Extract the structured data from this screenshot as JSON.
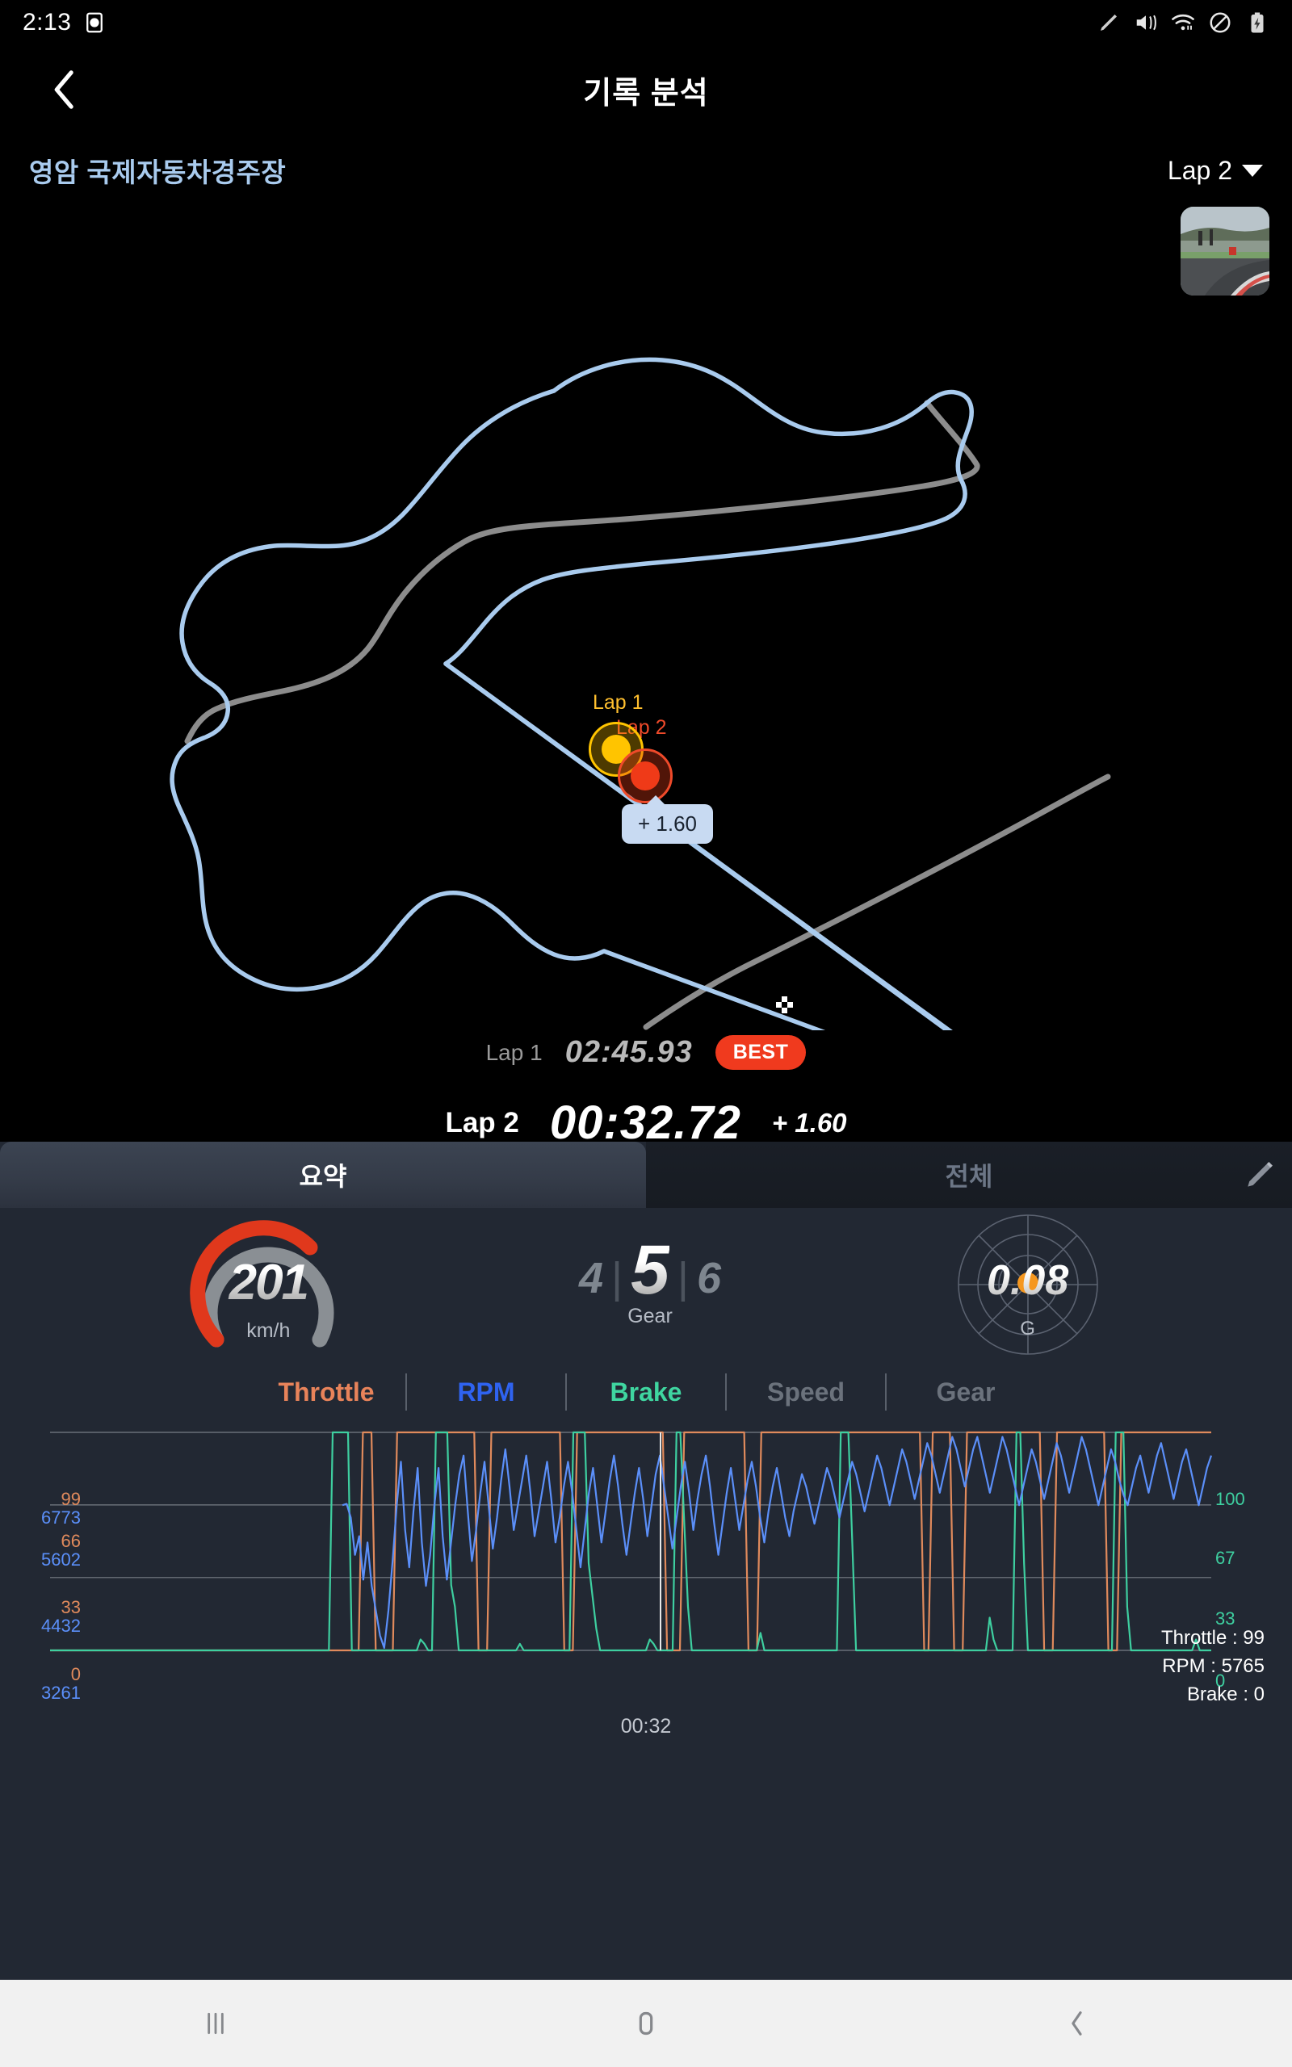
{
  "status_bar": {
    "time": "2:13",
    "icons": [
      "stylus-icon",
      "mute-vibrate-icon",
      "wifi-icon",
      "do-not-disturb-icon",
      "battery-charging-icon"
    ]
  },
  "header": {
    "title": "기록 분석",
    "back_icon": "back-chevron-icon"
  },
  "track": {
    "name": "영암 국제자동차경주장",
    "lap_selector": "Lap 2",
    "caret_icon": "chevron-down-icon",
    "thumbnail_label": "track-photo-thumbnail"
  },
  "map": {
    "marker1_label": "Lap 1",
    "marker2_label": "Lap 2",
    "tooltip": "+ 1.60",
    "marker1_color": "#ffc400",
    "marker2_color": "#ef3a18",
    "reference_line_color": "#a9cbee",
    "comparison_line_color": "#8c8c8c"
  },
  "laps": {
    "lap1_name": "Lap 1",
    "lap1_time": "02:45.93",
    "best_badge": "BEST",
    "lap2_name": "Lap 2",
    "lap2_time": "00:32.72",
    "lap2_delta": "+ 1.60"
  },
  "tabs": {
    "summary": "요약",
    "all": "전체",
    "edit_icon": "pencil-icon",
    "active": "요약"
  },
  "gauges": {
    "speed": {
      "value": "201",
      "unit": "km/h",
      "arc_pct": 72,
      "color": "#e0381c"
    },
    "gear": {
      "prev": "4",
      "current": "5",
      "next": "6",
      "label": "Gear"
    },
    "gforce": {
      "value": "0.08",
      "label": "G",
      "dot_color": "#f5971f"
    }
  },
  "legend": [
    {
      "label": "Throttle",
      "color": "#e8835a"
    },
    {
      "label": "RPM",
      "color": "#2f63f0"
    },
    {
      "label": "Brake",
      "color": "#3fd6a0"
    },
    {
      "label": "Speed",
      "color": "#6b727c"
    },
    {
      "label": "Gear",
      "color": "#6b727c"
    }
  ],
  "hud": {
    "throttle": "Throttle : 99",
    "rpm": "RPM : 5765",
    "brake": "Brake : 0"
  },
  "chart_data": {
    "type": "line",
    "title": "",
    "xlabel": "",
    "ylabel": "",
    "x_ticks": [
      "00:32"
    ],
    "grid": true,
    "legend_position": "above",
    "axes": {
      "left_throttle": {
        "ticks": [
          "99",
          "66",
          "33",
          "0"
        ],
        "color": "#e08a5c",
        "range": [
          0,
          99
        ]
      },
      "left_rpm": {
        "ticks": [
          "6773",
          "5602",
          "4432",
          "3261"
        ],
        "color": "#5b8ff9",
        "range": [
          3261,
          6773
        ]
      },
      "right_brake": {
        "ticks": [
          "100",
          "67",
          "33",
          "0"
        ],
        "color": "#3ecfa0",
        "range": [
          0,
          100
        ]
      }
    },
    "series": [
      {
        "name": "Throttle",
        "color": "#e08a5c",
        "values": [
          0,
          0,
          0,
          0,
          0,
          0,
          0,
          0,
          0,
          0,
          0,
          0,
          0,
          0,
          0,
          0,
          0,
          0,
          0,
          0,
          0,
          0,
          0,
          0,
          0,
          0,
          0,
          0,
          0,
          0,
          0,
          0,
          0,
          0,
          0,
          0,
          0,
          0,
          0,
          0,
          0,
          0,
          0,
          0,
          0,
          0,
          0,
          0,
          0,
          0,
          0,
          0,
          0,
          0,
          0,
          0,
          0,
          0,
          0,
          0,
          0,
          0,
          0,
          0,
          0,
          0,
          0,
          0,
          0,
          0,
          0,
          0,
          0,
          99,
          99,
          99,
          0,
          0,
          0,
          0,
          0,
          99,
          99,
          99,
          99,
          99,
          99,
          99,
          99,
          99,
          99,
          99,
          99,
          99,
          99,
          99,
          99,
          99,
          99,
          99,
          0,
          0,
          0,
          99,
          99,
          99,
          99,
          99,
          99,
          99,
          99,
          99,
          99,
          99,
          99,
          99,
          99,
          99,
          99,
          99,
          0,
          0,
          0,
          99,
          99,
          99,
          99,
          99,
          99,
          99,
          99,
          99,
          99,
          99,
          99,
          99,
          99,
          99,
          99,
          99,
          99,
          99,
          99,
          99,
          0,
          0,
          0,
          0,
          99,
          99,
          99,
          99,
          99,
          99,
          99,
          99,
          99,
          99,
          99,
          99,
          99,
          99,
          99,
          0,
          0,
          0,
          99,
          99,
          99,
          99,
          99,
          99,
          99,
          99,
          99,
          99,
          99,
          99,
          99,
          99,
          99,
          99,
          99,
          99,
          99,
          99,
          99,
          99,
          99,
          99,
          99,
          99,
          99,
          99,
          99,
          99,
          99,
          99,
          99,
          99,
          99,
          99,
          99,
          99,
          0,
          0,
          99,
          99,
          99,
          99,
          99,
          0,
          0,
          0,
          99,
          99,
          99,
          99,
          99,
          99,
          99,
          99,
          99,
          99,
          99,
          99,
          99,
          99,
          99,
          99,
          99,
          99,
          0,
          0,
          0,
          99,
          99,
          99,
          99,
          99,
          99,
          99,
          99,
          99,
          99,
          99,
          99,
          0,
          0,
          0,
          99,
          99,
          99,
          99,
          99,
          99,
          99,
          99,
          99,
          99,
          99,
          99,
          99,
          99,
          99,
          99,
          99,
          99,
          99,
          99,
          99,
          99
        ]
      },
      {
        "name": "RPM",
        "color": "#5b8ff9",
        "values": [
          null,
          null,
          null,
          null,
          null,
          null,
          null,
          null,
          null,
          null,
          null,
          null,
          null,
          null,
          null,
          null,
          null,
          null,
          null,
          null,
          null,
          null,
          null,
          null,
          null,
          null,
          null,
          null,
          null,
          null,
          null,
          null,
          null,
          null,
          null,
          null,
          null,
          null,
          null,
          null,
          null,
          null,
          null,
          null,
          null,
          null,
          null,
          null,
          null,
          null,
          null,
          null,
          null,
          null,
          null,
          null,
          null,
          null,
          null,
          null,
          null,
          null,
          null,
          null,
          null,
          null,
          null,
          null,
          null,
          null,
          5600,
          5620,
          5400,
          4800,
          5100,
          4400,
          5000,
          4300,
          3900,
          3500,
          3300,
          3900,
          4700,
          5600,
          6300,
          5200,
          4600,
          5500,
          6200,
          5000,
          4300,
          4800,
          5600,
          6200,
          5100,
          4400,
          5000,
          5600,
          6100,
          6400,
          5500,
          4700,
          5200,
          5800,
          6300,
          5600,
          4900,
          5400,
          6000,
          6500,
          5900,
          5200,
          5600,
          6000,
          6400,
          5800,
          5100,
          5500,
          5900,
          6300,
          5700,
          5000,
          5400,
          5900,
          6300,
          5800,
          5200,
          4600,
          5200,
          5800,
          6200,
          5600,
          5000,
          5500,
          6000,
          6400,
          5900,
          5300,
          4800,
          5300,
          5800,
          6200,
          5700,
          5100,
          5600,
          6100,
          6400,
          5900,
          5400,
          4900,
          5400,
          5900,
          6300,
          5800,
          5200,
          5700,
          6100,
          6400,
          5900,
          5300,
          4800,
          5300,
          5800,
          6200,
          5700,
          5200,
          5600,
          6000,
          6300,
          5900,
          5400,
          5000,
          5500,
          5900,
          6200,
          5800,
          5400,
          5100,
          5500,
          5800,
          6100,
          5900,
          5600,
          5300,
          5600,
          5900,
          6200,
          6000,
          5700,
          5400,
          5700,
          6000,
          6300,
          6100,
          5800,
          5500,
          5800,
          6100,
          6400,
          6200,
          5900,
          5600,
          5900,
          6200,
          6500,
          6300,
          6000,
          5700,
          6000,
          6300,
          6600,
          6400,
          6100,
          5800,
          6100,
          6400,
          6700,
          6500,
          6200,
          5900,
          6200,
          6500,
          6700,
          6400,
          6100,
          5800,
          6100,
          6400,
          6700,
          6500,
          6200,
          5900,
          5600,
          5900,
          6200,
          6500,
          6300,
          6000,
          5700,
          6000,
          6300,
          6600,
          6400,
          6100,
          5800,
          6100,
          6400,
          6700,
          6500,
          6200,
          5900,
          5600,
          5900,
          6200,
          6500,
          6300,
          6000,
          5765,
          5600,
          5900,
          6200,
          6400,
          6100,
          5800,
          6100,
          6400,
          6600,
          6300,
          6000,
          5700,
          6000,
          6300,
          6500,
          6200,
          5900,
          5600,
          5900,
          6200,
          6400
        ]
      },
      {
        "name": "Brake",
        "color": "#3ecfa0",
        "values": [
          0,
          0,
          0,
          0,
          0,
          0,
          0,
          0,
          0,
          0,
          0,
          0,
          0,
          0,
          0,
          0,
          0,
          0,
          0,
          0,
          0,
          0,
          0,
          0,
          0,
          0,
          0,
          0,
          0,
          0,
          0,
          0,
          0,
          0,
          0,
          0,
          0,
          0,
          0,
          0,
          0,
          0,
          0,
          0,
          0,
          0,
          0,
          0,
          0,
          0,
          0,
          0,
          0,
          0,
          0,
          0,
          0,
          0,
          0,
          0,
          0,
          0,
          0,
          0,
          0,
          0,
          0,
          0,
          0,
          0,
          0,
          0,
          0,
          0,
          100,
          100,
          100,
          100,
          100,
          0,
          0,
          0,
          0,
          0,
          0,
          0,
          0,
          0,
          0,
          0,
          0,
          0,
          0,
          0,
          0,
          0,
          0,
          5,
          3,
          0,
          0,
          100,
          100,
          100,
          100,
          30,
          20,
          0,
          0,
          0,
          0,
          0,
          0,
          0,
          0,
          0,
          0,
          0,
          0,
          0,
          0,
          0,
          0,
          3,
          0,
          0,
          0,
          0,
          0,
          0,
          0,
          0,
          0,
          0,
          0,
          0,
          0,
          100,
          100,
          100,
          100,
          40,
          25,
          10,
          0,
          0,
          0,
          0,
          0,
          0,
          0,
          0,
          0,
          0,
          0,
          0,
          0,
          5,
          3,
          0,
          0,
          0,
          0,
          0,
          100,
          100,
          60,
          20,
          0,
          0,
          0,
          0,
          0,
          0,
          0,
          0,
          0,
          0,
          0,
          0,
          0,
          0,
          0,
          0,
          0,
          0,
          8,
          0,
          0,
          0,
          0,
          0,
          0,
          0,
          0,
          0,
          0,
          0,
          0,
          0,
          0,
          0,
          0,
          0,
          0,
          0,
          0,
          100,
          100,
          100,
          50,
          0,
          0,
          0,
          0,
          0,
          0,
          0,
          0,
          0,
          0,
          0,
          0,
          0,
          0,
          0,
          0,
          0,
          0,
          0,
          0,
          0,
          0,
          0,
          0,
          0,
          0,
          0,
          0,
          0,
          0,
          0,
          0,
          0,
          0,
          0,
          15,
          5,
          0,
          0,
          0,
          0,
          0,
          100,
          100,
          40,
          0,
          0,
          0,
          0,
          0,
          0,
          0,
          0,
          0,
          0,
          0,
          0,
          0,
          0,
          0,
          0,
          0,
          0,
          0,
          0,
          0,
          0,
          0,
          100,
          100,
          100,
          20,
          0,
          0,
          0,
          0,
          0,
          0,
          0,
          0,
          0,
          0,
          0,
          0,
          0,
          0,
          0,
          0,
          0,
          5,
          0,
          0,
          0,
          0
        ]
      }
    ]
  },
  "nav": {
    "recents_icon": "recents-icon",
    "home_icon": "home-icon",
    "back_icon": "back-icon"
  }
}
